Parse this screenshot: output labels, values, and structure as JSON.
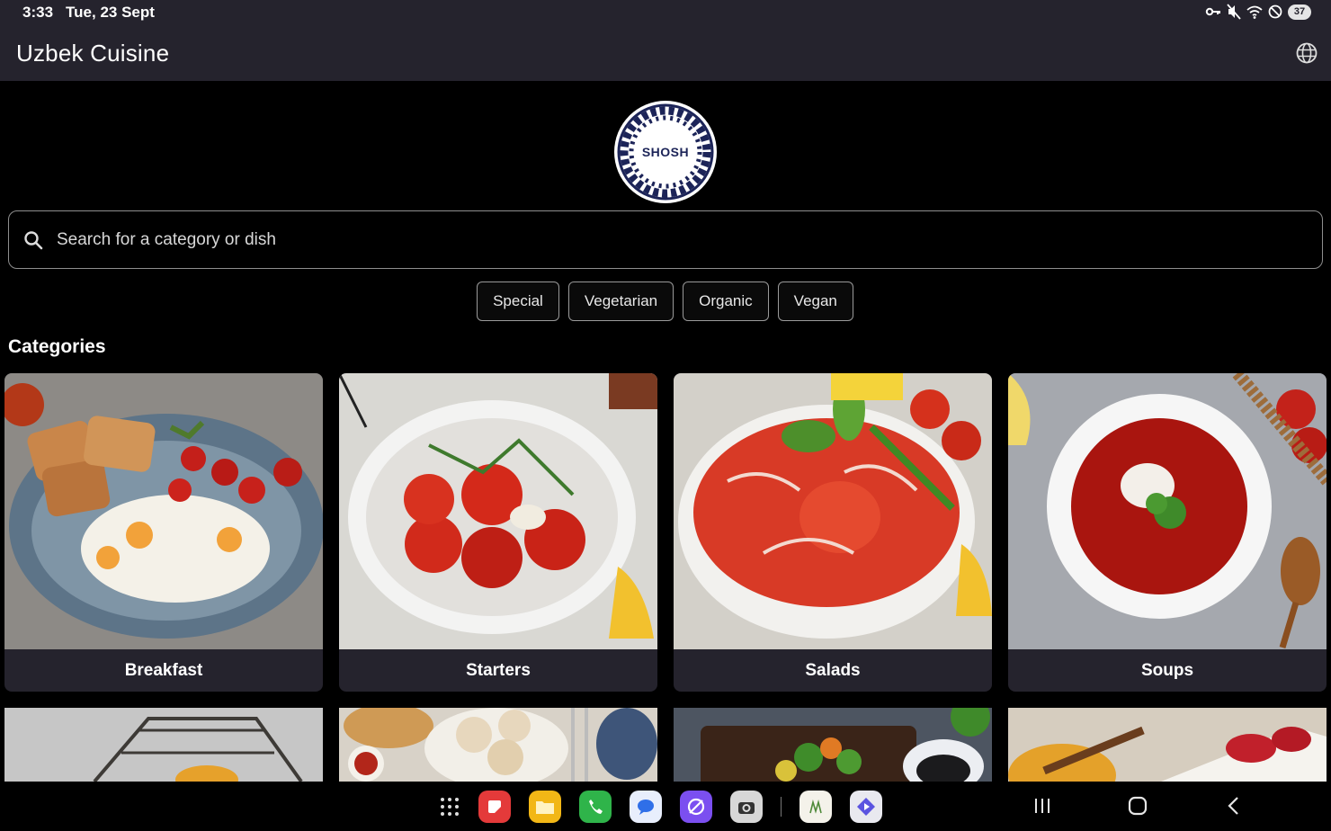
{
  "status_bar": {
    "time": "3:33",
    "date": "Tue, 23 Sept",
    "battery": "37",
    "icons": [
      "key-icon",
      "mute-icon",
      "wifi-icon",
      "do-not-disturb-icon",
      "battery-icon"
    ]
  },
  "app_bar": {
    "title": "Uzbek Cuisine",
    "language_icon": "globe-icon"
  },
  "logo": {
    "text": "SHOSH",
    "color": "#1c2458"
  },
  "search": {
    "placeholder": "Search for a category or dish",
    "value": ""
  },
  "filters": [
    {
      "label": "Special"
    },
    {
      "label": "Vegetarian"
    },
    {
      "label": "Organic"
    },
    {
      "label": "Vegan"
    }
  ],
  "categories_title": "Categories",
  "categories": [
    {
      "label": "Breakfast"
    },
    {
      "label": "Starters"
    },
    {
      "label": "Salads"
    },
    {
      "label": "Soups"
    }
  ],
  "dock_apps": [
    "apps-grid-icon",
    "notes-app-icon",
    "files-app-icon",
    "phone-app-icon",
    "messages-app-icon",
    "internet-app-icon",
    "camera-app-icon",
    "restaurant-app-icon",
    "media-app-icon"
  ],
  "colors": {
    "bar_background": "#25232d",
    "page_background": "#000000",
    "card_background": "#25232d"
  }
}
